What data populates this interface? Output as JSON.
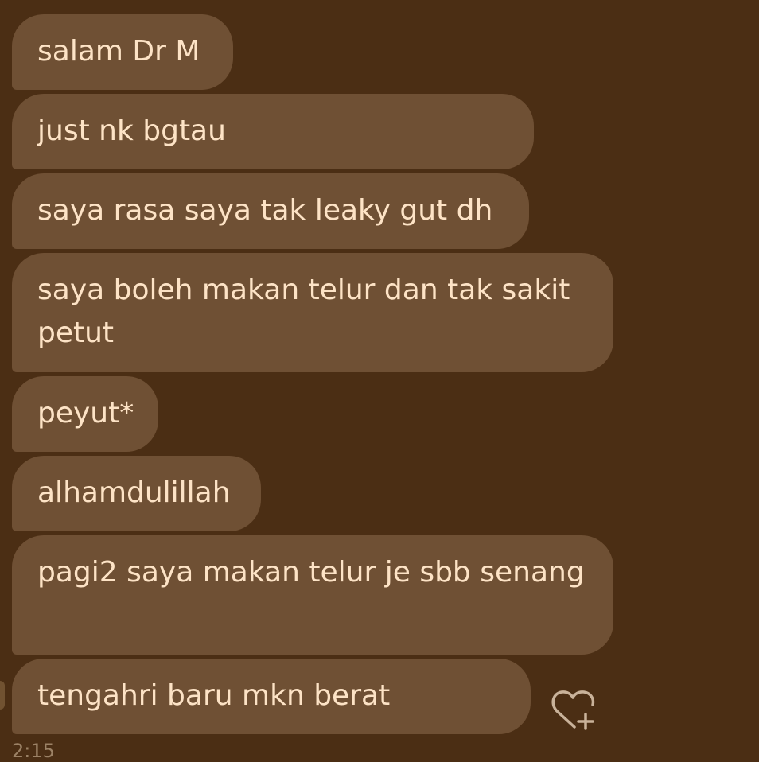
{
  "conversation": {
    "messages": [
      {
        "text": "salam Dr M"
      },
      {
        "text": "just nk bgtau"
      },
      {
        "text": "saya rasa saya tak leaky gut dh"
      },
      {
        "text": "saya boleh makan telur dan tak sakit petut"
      },
      {
        "text": "peyut*"
      },
      {
        "text": "alhamdulillah"
      },
      {
        "text": "pagi2 saya makan telur je sbb senang"
      },
      {
        "text": "tengahri baru mkn berat"
      }
    ],
    "timestamp": "2:15"
  },
  "icons": {
    "reaction": "heart-plus-icon",
    "avatar": "avatar"
  },
  "colors": {
    "background": "#4b2e14",
    "bubble": "#6f5034",
    "text": "#fde3c6",
    "icon": "#c9b29a"
  }
}
